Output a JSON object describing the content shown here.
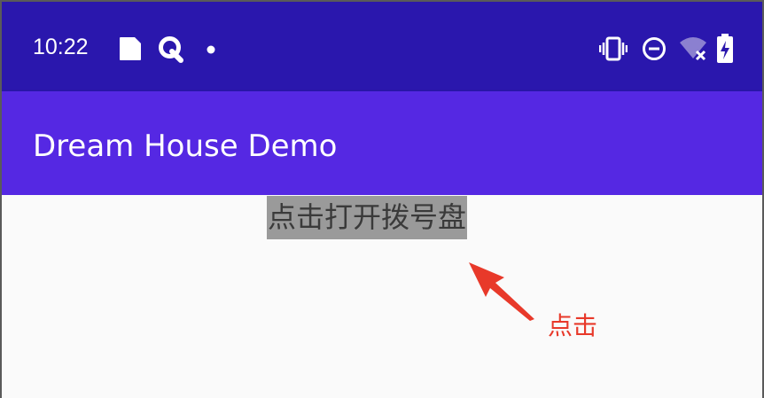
{
  "status_bar": {
    "time": "10:22",
    "left_icons": [
      "sim-card-icon",
      "q-app-icon",
      "notification-dot-icon"
    ],
    "right_icons": [
      "vibrate-icon",
      "do-not-disturb-icon",
      "wifi-off-icon",
      "battery-charging-icon"
    ],
    "background": "#2a17ad"
  },
  "app_bar": {
    "title": "Dream House Demo",
    "background": "#5528e3"
  },
  "content": {
    "dial_button_label": "点击打开拨号盘",
    "annotation_label": "点击",
    "annotation_color": "#e8392a",
    "highlight_color": "#9a9a9a"
  }
}
